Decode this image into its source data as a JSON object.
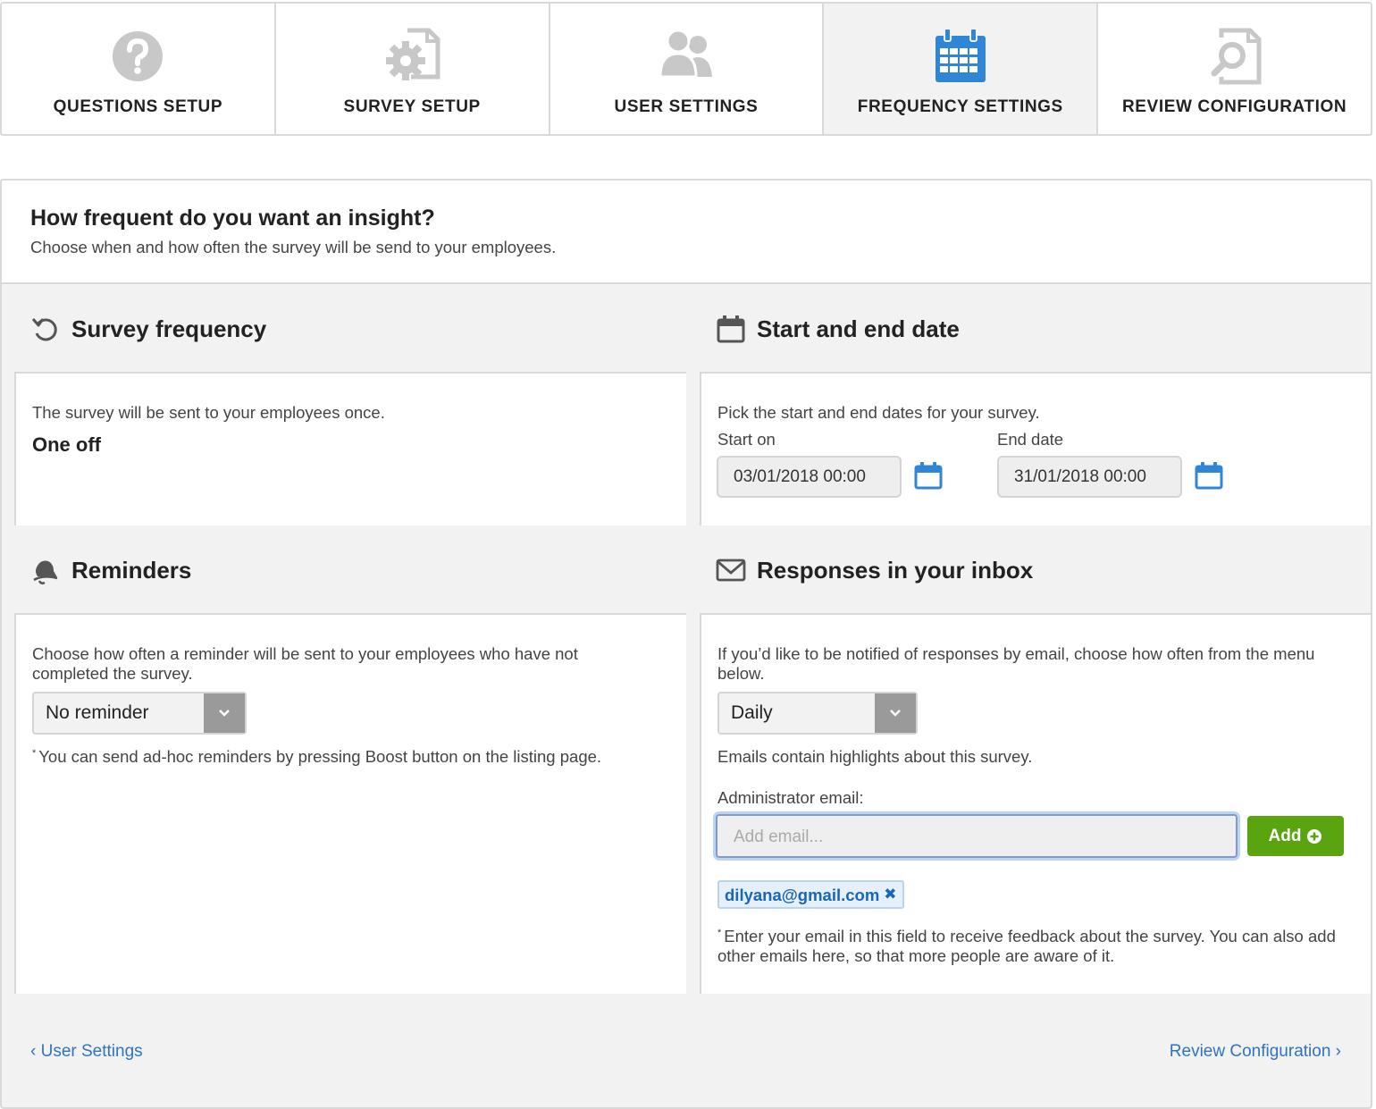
{
  "tabs": [
    {
      "label": "QUESTIONS SETUP",
      "icon": "question-circle-icon"
    },
    {
      "label": "SURVEY SETUP",
      "icon": "document-gear-icon"
    },
    {
      "label": "USER SETTINGS",
      "icon": "users-icon"
    },
    {
      "label": "FREQUENCY SETTINGS",
      "icon": "calendar-icon",
      "active": true
    },
    {
      "label": "REVIEW CONFIGURATION",
      "icon": "document-search-icon"
    }
  ],
  "colors": {
    "accent_blue": "#2f86d6",
    "inactive_icon": "#c8c8c8",
    "add_green": "#5aa410",
    "link_blue": "#2f74c0"
  },
  "header": {
    "title": "How frequent do you want an insight?",
    "subtitle": "Choose when and how often the survey will be send to your employees."
  },
  "frequency": {
    "title": "Survey frequency",
    "description": "The survey will be sent to your employees once.",
    "value": "One off"
  },
  "dates": {
    "title": "Start and end date",
    "description": "Pick the start and end dates for your survey.",
    "start_label": "Start on",
    "start_value": "03/01/2018 00:00",
    "end_label": "End date",
    "end_value": "31/01/2018 00:00"
  },
  "reminders": {
    "title": "Reminders",
    "description": "Choose how often a reminder will be sent to your employees who have not completed the survey.",
    "selected": "No reminder",
    "note_mark": "*",
    "note": "You can send ad-hoc reminders by pressing Boost button on the listing page."
  },
  "inbox": {
    "title": "Responses in your inbox",
    "description": "If you’d like to be notified of responses by email, choose how often from the menu below.",
    "selected": "Daily",
    "info": "Emails contain highlights about this survey.",
    "admin_label": "Administrator email:",
    "email_placeholder": "Add email...",
    "add_label": "Add",
    "emails": [
      "dilyana@gmail.com"
    ],
    "remove_glyph": "✖",
    "note_mark": "*",
    "note": "Enter your email in this field to receive feedback about the survey. You can also add other emails here, so that more people are aware of it."
  },
  "footer": {
    "back_label": "‹ User Settings",
    "next_label": "Review Configuration ›"
  }
}
